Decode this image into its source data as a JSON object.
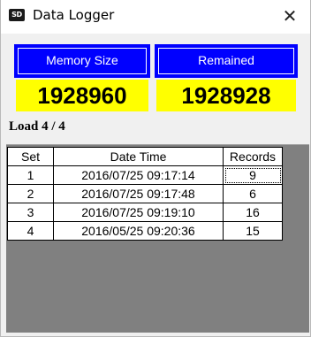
{
  "window": {
    "icon": "sd-card-icon",
    "icon_text": "SD",
    "title": "Data Logger",
    "close_glyph": "✕"
  },
  "memory": {
    "size_label": "Memory Size",
    "size_value": "1928960",
    "remained_label": "Remained",
    "remained_value": "1928928"
  },
  "load_text": "Load  4 / 4",
  "table": {
    "headers": [
      "Set",
      "Date Time",
      "Records"
    ],
    "rows": [
      [
        "1",
        "2016/07/25 09:17:14",
        "9"
      ],
      [
        "2",
        "2016/07/25 09:17:48",
        "6"
      ],
      [
        "3",
        "2016/07/25 09:19:10",
        "16"
      ],
      [
        "4",
        "2016/05/25 09:20:36",
        "15"
      ]
    ]
  },
  "colors": {
    "label_bg": "#0000ff",
    "value_bg": "#ffff00",
    "grid_bg": "#808080"
  }
}
